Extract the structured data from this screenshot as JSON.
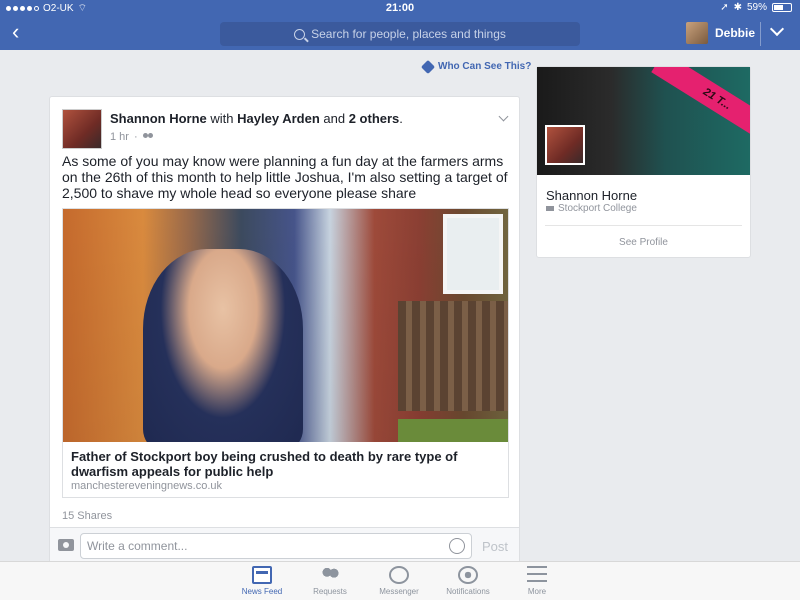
{
  "status_bar": {
    "carrier": "O2-UK",
    "time": "21:00",
    "battery": "59%",
    "battery_level": 0.59,
    "signal_bars": 4
  },
  "nav": {
    "search_placeholder": "Search for people, places and things",
    "user_name": "Debbie"
  },
  "privacy_link": "Who Can See This?",
  "post": {
    "author": "Shannon Horne",
    "with_word": "with",
    "tagged": "Hayley Arden",
    "and_word": "and",
    "others": "2 others",
    "period": ".",
    "time": "1 hr",
    "text": "As some of you may know were planning a fun day at the farmers arms on the 26th of this month to help little Joshua, I'm also setting a target of 2,500 to shave my whole head so everyone please share",
    "link_title": "Father of Stockport boy being crushed to death by rare type of dwarfism appeals for public help",
    "link_domain": "manchestereveningnews.co.uk",
    "shares": "15 Shares",
    "comment_placeholder": "Write a comment...",
    "post_button": "Post"
  },
  "profile_card": {
    "name": "Shannon Horne",
    "school": "Stockport College",
    "see_profile": "See Profile"
  },
  "tabbar": {
    "tabs": [
      {
        "label": "News Feed",
        "icon": "news-feed-icon"
      },
      {
        "label": "Requests",
        "icon": "requests-icon"
      },
      {
        "label": "Messenger",
        "icon": "messenger-icon"
      },
      {
        "label": "Notifications",
        "icon": "notifications-icon"
      },
      {
        "label": "More",
        "icon": "more-icon"
      }
    ]
  },
  "colors": {
    "brand": "#4267b2",
    "background": "#e9ebee"
  }
}
